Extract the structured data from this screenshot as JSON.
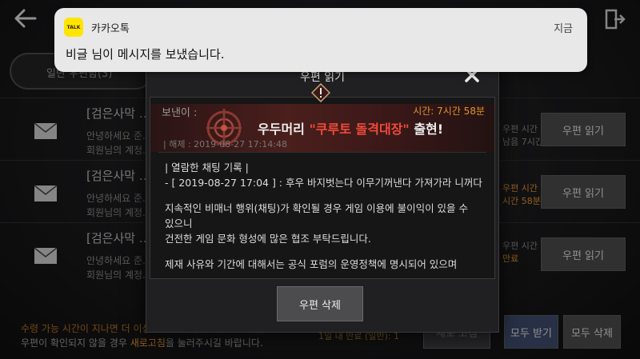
{
  "notification": {
    "app_name": "카카오톡",
    "time": "지금",
    "message": "비글 님이 메시지를 보냈습니다.",
    "icon_text": "TALK"
  },
  "tab": {
    "label": "일반 우편함(3)"
  },
  "mail_list": [
    {
      "subject": "[검은사막 ...",
      "line1": "안녕하세요 준...",
      "line2": "회원님의 계정...",
      "expire_line1": "우편 시간",
      "expire_line2": "남음 7시간",
      "read_label": "우편 읽기"
    },
    {
      "subject": "[검은사막 ...",
      "line1": "안녕하세요 준...",
      "line2": "회원님의 계정...",
      "expire_line1": "우편 시간",
      "expire_line2": "시간 58분",
      "read_label": "우편 읽기"
    },
    {
      "subject": "[검은사막 ...",
      "line1": "안녕하세요 준...",
      "line2": "회원님의 계정...",
      "expire_line1": "우편 시간",
      "expire_line2": "만료",
      "read_label": "우편 읽기"
    }
  ],
  "bottom": {
    "note1": "수령 가능 시간이 지나면 더 이상 물품을 수령할 수 없습니다.",
    "note2_pre": "우편이 확인되지 않을 경우 ",
    "note2_hl": "새로고침",
    "note2_post": "을 눌러주시길 바랍니다.",
    "count": "1일 내 만료 (일반): 1",
    "refresh_label": "새로 고침",
    "receive_all_label": "모두 받기",
    "delete_all_label": "모두 삭제"
  },
  "modal": {
    "title": "우편 읽기",
    "sender_label": "보낸이 :",
    "remain_time": "시간: 7시간 58분",
    "ribbon_pre": "우두머리 ",
    "ribbon_red": "\"쿠루토 돌격대장\"",
    "ribbon_post": " 출현!",
    "ribbon_sub": "| 해제 :    2019-08-27 17:14:48",
    "body": {
      "l1": "| 열람한 채팅 기록 |",
      "l2": "- [ 2019-08-27 17:04 ] : 후우 바지벗는다 이무기꺼낸다 가져가라 니꺼다",
      "l3": "지속적인 비매너 행위(채팅)가 확인될 경우 게임 이용에 불이익이 있을 수",
      "l4": "있으니",
      "l5": "건전한 게임 문화 형성에 많은 협조 부탁드립니다.",
      "l6": "제재 사유와 기간에 대해서는 공식 포럼의 운영정책에 명시되어 있으며"
    },
    "delete_label": "우편 삭제"
  },
  "colors": {
    "accent_orange": "#e0922d",
    "highlight_red": "#f04a3a",
    "kakao_yellow": "#fee500"
  }
}
